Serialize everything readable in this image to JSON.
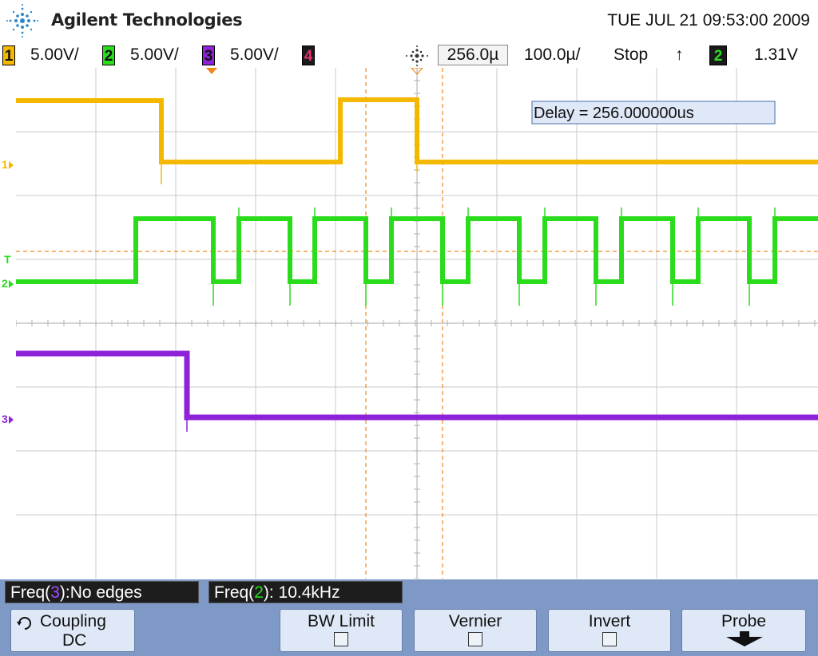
{
  "header": {
    "brand": "Agilent Technologies",
    "datetime": "TUE JUL 21 09:53:00 2009"
  },
  "status": {
    "channels": [
      {
        "num": "1",
        "scale": "5.00V/",
        "color": "#f5b800"
      },
      {
        "num": "2",
        "scale": "5.00V/",
        "color": "#2bdc1d"
      },
      {
        "num": "3",
        "scale": "5.00V/",
        "color": "#8e22d8"
      },
      {
        "num": "4",
        "color": "#e8306a"
      }
    ],
    "delay_value": "256.0µ",
    "timebase": "100.0µ/",
    "run_state": "Stop",
    "trigger_slope": "↑",
    "trigger_source": "2",
    "trigger_level": "1.31V"
  },
  "display": {
    "delay_readout": "Delay = 256.000000us",
    "markers": {
      "ch1": "1",
      "ch2": "2",
      "ch3": "3",
      "trigger": "T"
    }
  },
  "measurements": [
    {
      "label": "Freq(",
      "channel": "3",
      "value": "):No edges"
    },
    {
      "label": "Freq(",
      "channel": "2",
      "value": "): 10.4kHz"
    }
  ],
  "softkeys": {
    "coupling_label": "Coupling",
    "coupling_value": "DC",
    "bw_limit": "BW Limit",
    "vernier": "Vernier",
    "invert": "Invert",
    "probe": "Probe"
  },
  "colors": {
    "ch1": "#f5b800",
    "ch2": "#2bdc1d",
    "ch3": "#8e22d8",
    "cursor": "#f08a1c",
    "grid": "#c8c8c8"
  }
}
